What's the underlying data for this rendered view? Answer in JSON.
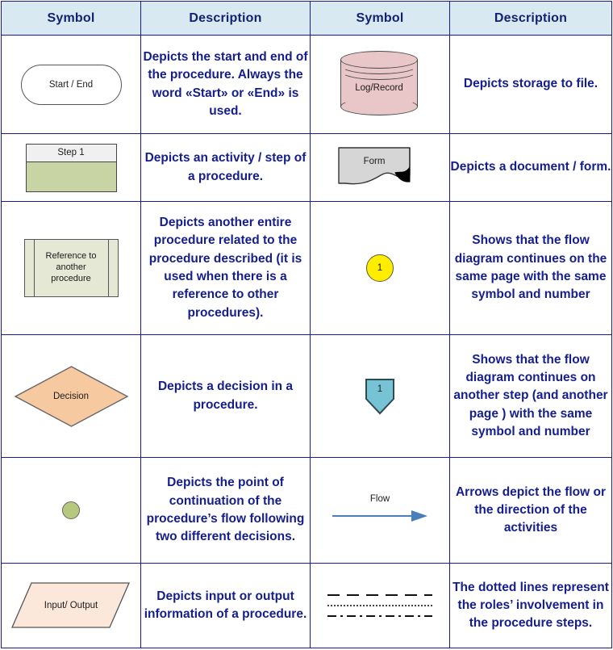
{
  "table": {
    "headers": {
      "symbol_left": "Symbol",
      "description_left": "Description",
      "symbol_right": "Symbol",
      "description_right": "Description"
    },
    "rows": [
      {
        "left": {
          "symbol_type": "terminator",
          "symbol_label": "Start / End",
          "description": "Depicts the start and end of the procedure. Always the word «Start» or «End» is used."
        },
        "right": {
          "symbol_type": "stored-data-cylinder",
          "symbol_label": "Log/Record",
          "description": "Depicts storage to file."
        }
      },
      {
        "left": {
          "symbol_type": "process-step",
          "symbol_label": "Step 1",
          "description": "Depicts an activity / step of a procedure."
        },
        "right": {
          "symbol_type": "document",
          "symbol_label": "Form",
          "description": "Depicts a document / form."
        }
      },
      {
        "left": {
          "symbol_type": "predefined-process",
          "symbol_label": "Reference to\nanother\nprocedure",
          "description": "Depicts another entire procedure related to the procedure described (it is used when there is a reference to other procedures)."
        },
        "right": {
          "symbol_type": "on-page-connector",
          "symbol_label": "1",
          "description": "Shows that the flow diagram continues on the same page with the same symbol and number"
        }
      },
      {
        "left": {
          "symbol_type": "decision-diamond",
          "symbol_label": "Decision",
          "description": "Depicts a decision in a procedure."
        },
        "right": {
          "symbol_type": "off-page-connector",
          "symbol_label": "1",
          "description": "Shows that the flow diagram continues on another step (and another page ) with the same symbol and number"
        }
      },
      {
        "left": {
          "symbol_type": "merge-dot",
          "symbol_label": "",
          "description": "Depicts the point of continuation of the procedure’s flow following two different decisions."
        },
        "right": {
          "symbol_type": "flow-arrow",
          "symbol_label": "Flow",
          "description": "Arrows depict the flow or the direction of the activities"
        }
      },
      {
        "left": {
          "symbol_type": "input-output-parallelogram",
          "symbol_label": "Input/ Output",
          "description": "Depicts input or output information of a procedure."
        },
        "right": {
          "symbol_type": "role-divider-lines",
          "symbol_label": "",
          "description": "The dotted lines represent the roles’ involvement in the procedure steps."
        }
      }
    ]
  },
  "colors": {
    "border": "#1a1a8c",
    "header_fill": "#d9e9f2",
    "header_text": "#12226e",
    "description_text": "#141e8c",
    "cylinder_fill": "#e9c6c7",
    "step_fill": "#c9d4a4",
    "step_bar_fill": "#f0f0f0",
    "document_fill": "#d6d6d6",
    "predefined_fill": "#e4e8d4",
    "connector_fill": "#ffed00",
    "decision_fill": "#f7c9a0",
    "offpage_fill": "#76c3d6",
    "dot_fill": "#b5c97e",
    "arrow_color": "#4a7ebb",
    "io_fill": "#fbe8da"
  }
}
